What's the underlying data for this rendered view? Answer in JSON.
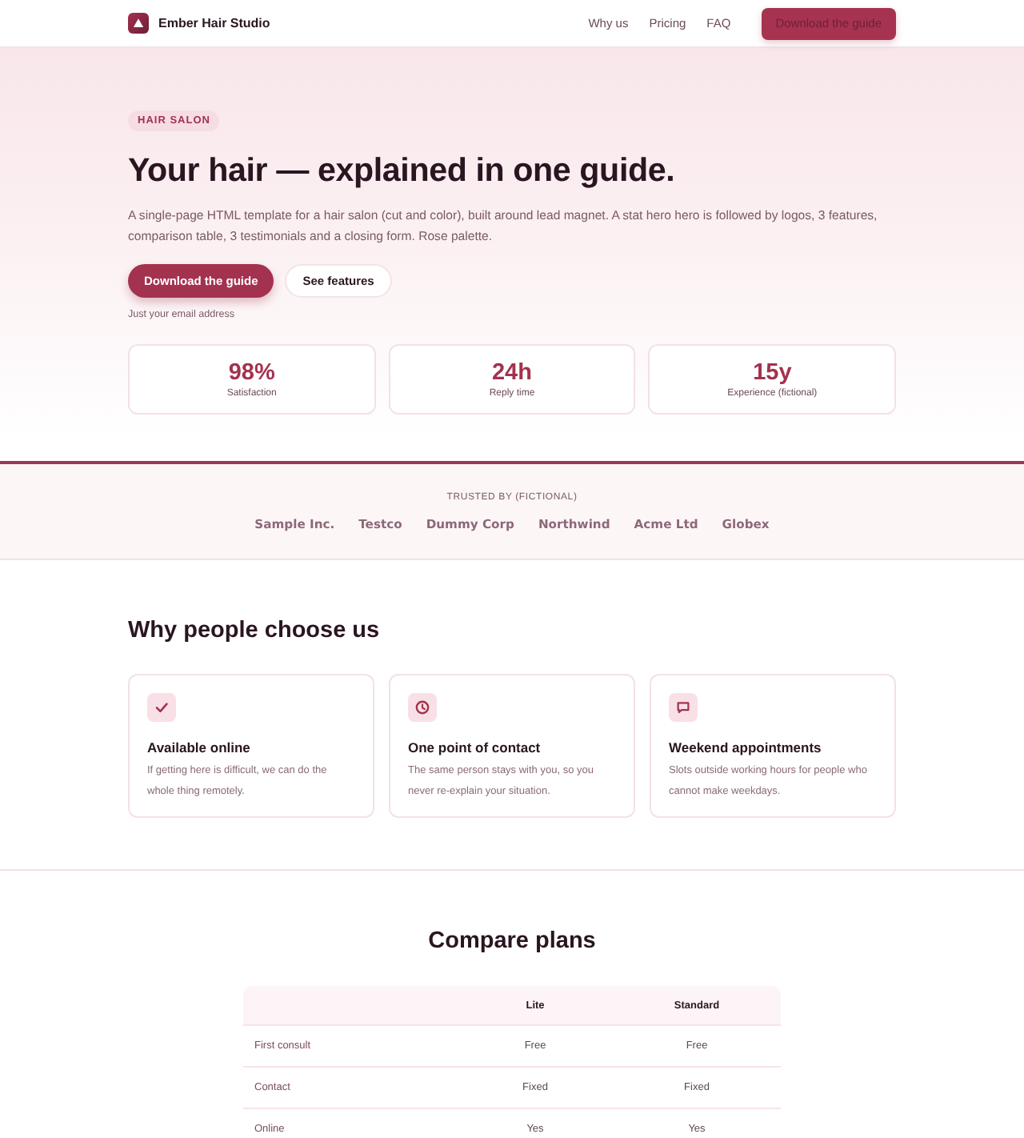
{
  "nav": {
    "brand": "Ember Hair Studio",
    "links": [
      {
        "label": "Why us"
      },
      {
        "label": "Pricing"
      },
      {
        "label": "FAQ"
      }
    ],
    "cta": "Download the guide"
  },
  "hero": {
    "badge": "HAIR SALON",
    "title": "Your hair — explained in one guide.",
    "description": "A single-page HTML template for a hair salon (cut and color), built around lead magnet. A stat hero hero is followed by logos, 3 features, comparison table, 3 testimonials and a closing form. Rose palette.",
    "primary_button": "Download the guide",
    "secondary_button": "See features",
    "note": "Just your email address",
    "stats": [
      {
        "value": "98%",
        "label": "Satisfaction"
      },
      {
        "value": "24h",
        "label": "Reply time"
      },
      {
        "value": "15y",
        "label": "Experience (fictional)"
      }
    ]
  },
  "logos": {
    "caption": "TRUSTED BY (FICTIONAL)",
    "names": [
      "Sample Inc.",
      "Testco",
      "Dummy Corp",
      "Northwind",
      "Acme Ltd",
      "Globex"
    ]
  },
  "features": {
    "title": "Why people choose us",
    "items": [
      {
        "kind": "check",
        "title": "Available online",
        "text": "If getting here is difficult, we can do the whole thing remotely."
      },
      {
        "kind": "clock",
        "title": "One point of contact",
        "text": "The same person stays with you, so you never re-explain your situation."
      },
      {
        "kind": "chat",
        "title": "Weekend appointments",
        "text": "Slots outside working hours for people who cannot make weekdays."
      }
    ]
  },
  "comparison": {
    "title": "Compare plans",
    "columns": [
      "Lite",
      "Standard"
    ],
    "rows": [
      {
        "label": "First consult",
        "values": [
          "Free",
          "Free"
        ]
      },
      {
        "label": "Contact",
        "values": [
          "Fixed",
          "Fixed"
        ]
      },
      {
        "label": "Online",
        "values": [
          "Yes",
          "Yes"
        ]
      }
    ]
  }
}
